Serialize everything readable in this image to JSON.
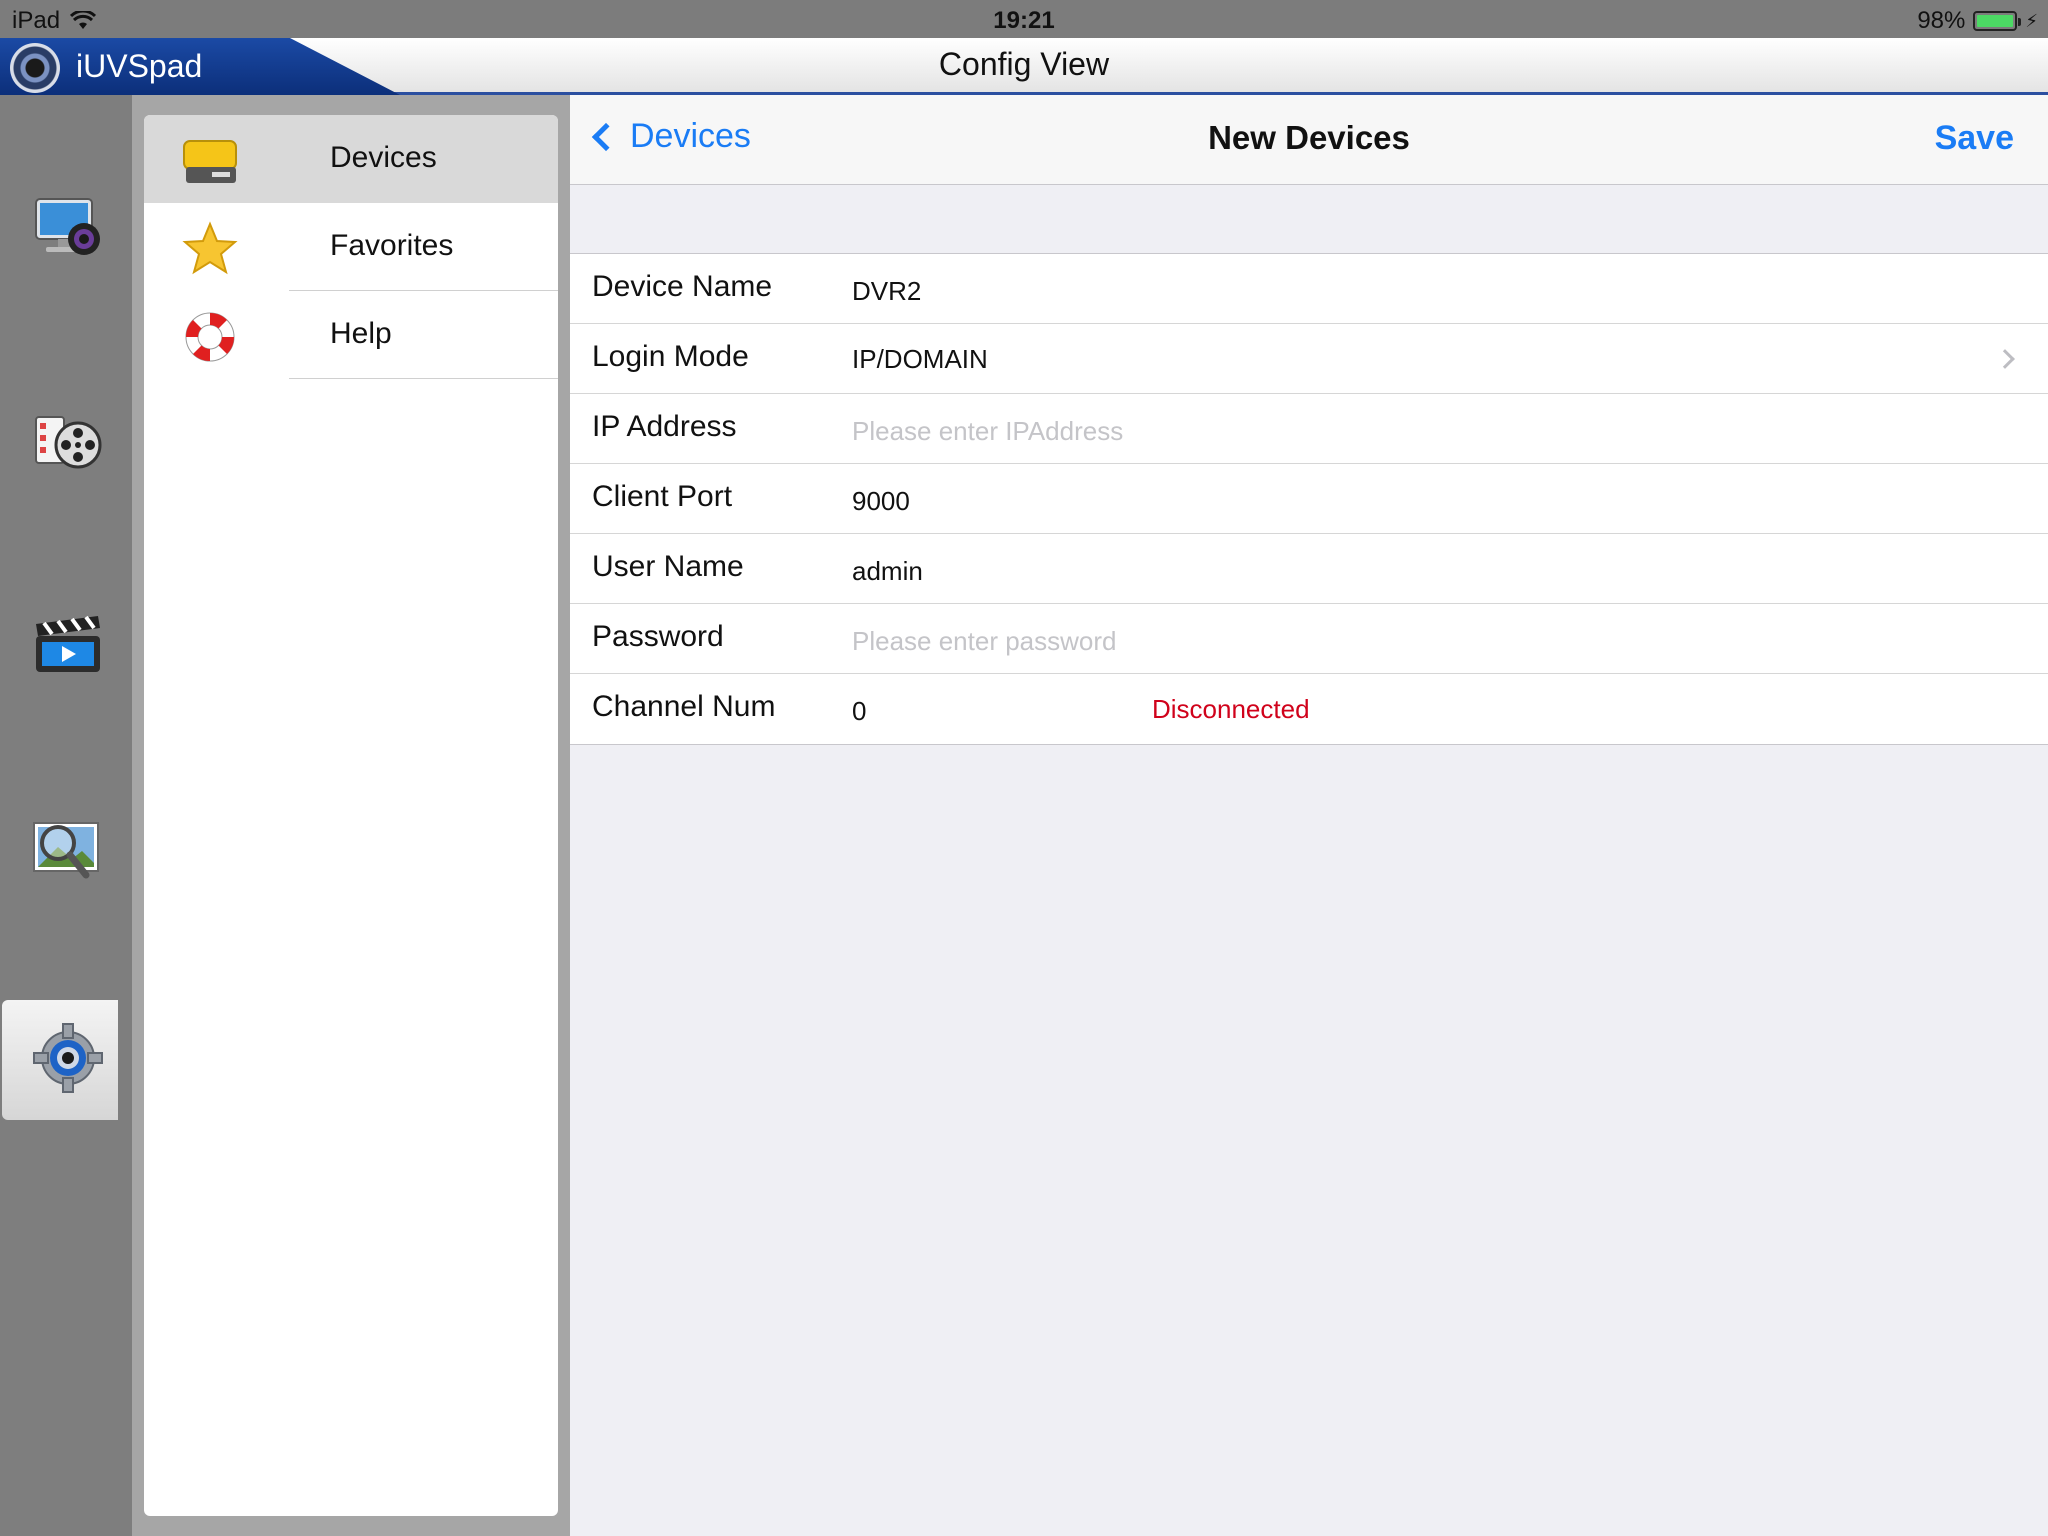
{
  "status_bar": {
    "device": "iPad",
    "time": "19:21",
    "battery": "98%"
  },
  "app": {
    "name": "iUVSpad",
    "title": "Config View"
  },
  "dock": {
    "items": [
      {
        "name": "live-view"
      },
      {
        "name": "playback"
      },
      {
        "name": "local-video"
      },
      {
        "name": "image-search"
      },
      {
        "name": "settings",
        "active": true
      }
    ]
  },
  "menu": {
    "items": [
      {
        "label": "Devices",
        "icon": "hard-drive-icon",
        "selected": true
      },
      {
        "label": "Favorites",
        "icon": "star-icon"
      },
      {
        "label": "Help",
        "icon": "lifebuoy-icon"
      }
    ]
  },
  "navbar": {
    "back_label": "Devices",
    "title": "New Devices",
    "save_label": "Save"
  },
  "form": {
    "device_name": {
      "label": "Device Name",
      "value": "DVR2"
    },
    "login_mode": {
      "label": "Login Mode",
      "value": "IP/DOMAIN"
    },
    "ip_address": {
      "label": "IP Address",
      "value": "",
      "placeholder": "Please enter IPAddress"
    },
    "client_port": {
      "label": "Client Port",
      "value": "9000"
    },
    "user_name": {
      "label": "User Name",
      "value": "admin"
    },
    "password": {
      "label": "Password",
      "value": "",
      "placeholder": "Please enter password"
    },
    "channel_num": {
      "label": "Channel Num",
      "value": "0",
      "status": "Disconnected"
    }
  },
  "colors": {
    "accent": "#1a7cf5",
    "error": "#d0021b",
    "brand": "#1b4aa5",
    "battery": "#4cd964"
  }
}
